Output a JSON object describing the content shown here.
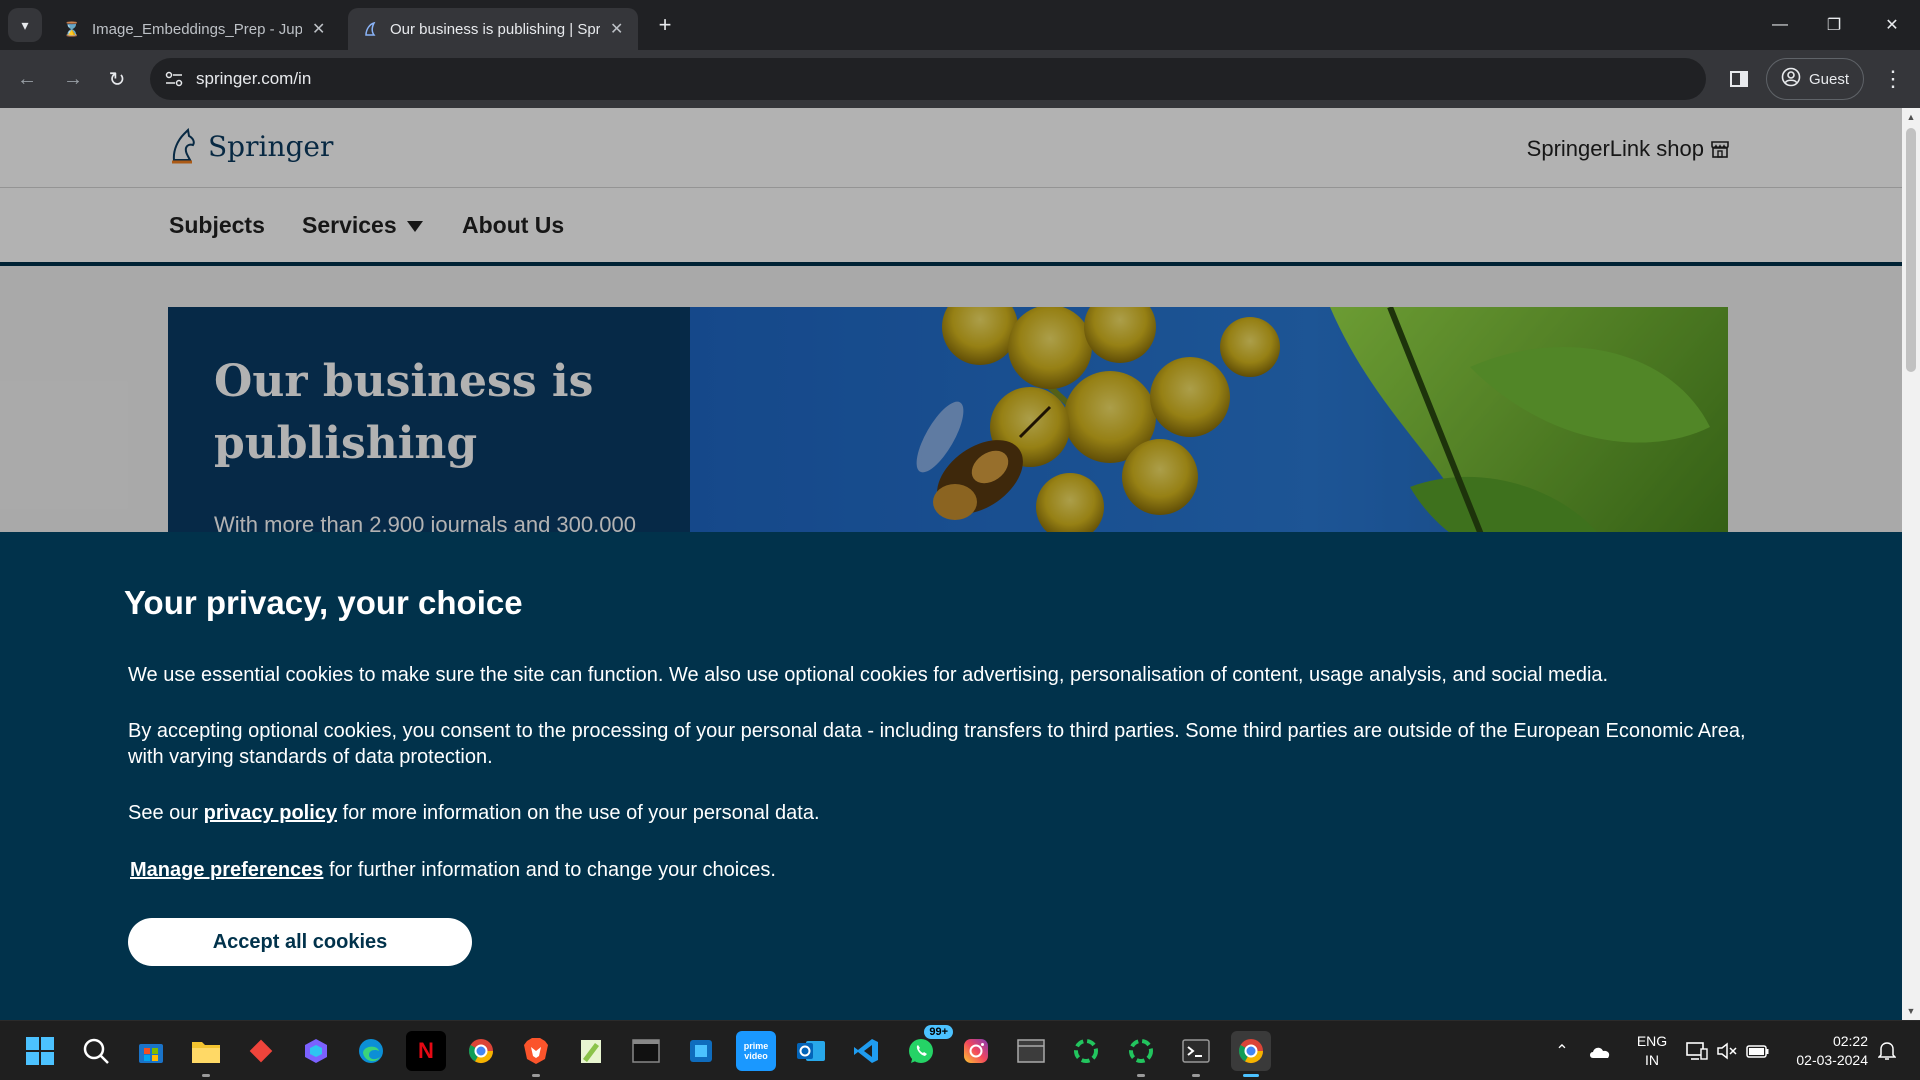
{
  "browser": {
    "tabs": [
      {
        "title": "Image_Embeddings_Prep - Jupyter",
        "active": false
      },
      {
        "title": "Our business is publishing | Springer",
        "active": true
      }
    ],
    "url": "springer.com/in",
    "profile_label": "Guest"
  },
  "site": {
    "logo_text": "Springer",
    "shop_link": "SpringerLink shop",
    "nav": [
      {
        "label": "Subjects"
      },
      {
        "label": "Services",
        "has_dropdown": true
      },
      {
        "label": "About Us"
      }
    ],
    "hero": {
      "title": "Our business is publishing",
      "subtitle": "With more than 2,900 journals and 300,000"
    }
  },
  "cookie_banner": {
    "title": "Your privacy, your choice",
    "p1": "We use essential cookies to make sure the site can function. We also use optional cookies for advertising, personalisation of content, usage analysis, and social media.",
    "p2": "By accepting optional cookies, you consent to the processing of your personal data - including transfers to third parties. Some third parties are outside of the European Economic Area, with varying standards of data protection.",
    "p3_prefix": "See our",
    "p3_link": "privacy policy",
    "p3_suffix": "for more information on the use of your personal data.",
    "p4_link": "Manage preferences",
    "p4_suffix": "for further information and to change your choices.",
    "accept_label": "Accept all cookies"
  },
  "taskbar": {
    "apps": [
      {
        "name": "start",
        "glyph": ""
      },
      {
        "name": "search",
        "glyph": ""
      },
      {
        "name": "microsoft-store",
        "glyph": ""
      },
      {
        "name": "file-explorer",
        "glyph": ""
      },
      {
        "name": "anydesk",
        "glyph": ""
      },
      {
        "name": "copilot",
        "glyph": ""
      },
      {
        "name": "edge",
        "glyph": ""
      },
      {
        "name": "netflix",
        "glyph": "N"
      },
      {
        "name": "chrome",
        "glyph": ""
      },
      {
        "name": "brave",
        "glyph": ""
      },
      {
        "name": "notepad-plus-plus",
        "glyph": ""
      },
      {
        "name": "terminal-app",
        "glyph": ""
      },
      {
        "name": "windows-app",
        "glyph": ""
      },
      {
        "name": "prime-video",
        "glyph": "prime\nvideo"
      },
      {
        "name": "outlook",
        "glyph": "O"
      },
      {
        "name": "vs-code",
        "glyph": ""
      },
      {
        "name": "whatsapp",
        "glyph": "",
        "badge": "99+"
      },
      {
        "name": "instagram",
        "glyph": ""
      },
      {
        "name": "window-app",
        "glyph": ""
      },
      {
        "name": "spinner-app-1",
        "glyph": ""
      },
      {
        "name": "spinner-app-2",
        "glyph": ""
      },
      {
        "name": "terminal",
        "glyph": ""
      },
      {
        "name": "chrome-active",
        "glyph": ""
      }
    ],
    "language": "ENG",
    "region": "IN",
    "time": "02:22",
    "date": "02-03-2024"
  },
  "colors": {
    "brand_navy": "#01324b",
    "hero_blue": "#0a3b66",
    "taskbar_accent": "#4cc2ff"
  }
}
